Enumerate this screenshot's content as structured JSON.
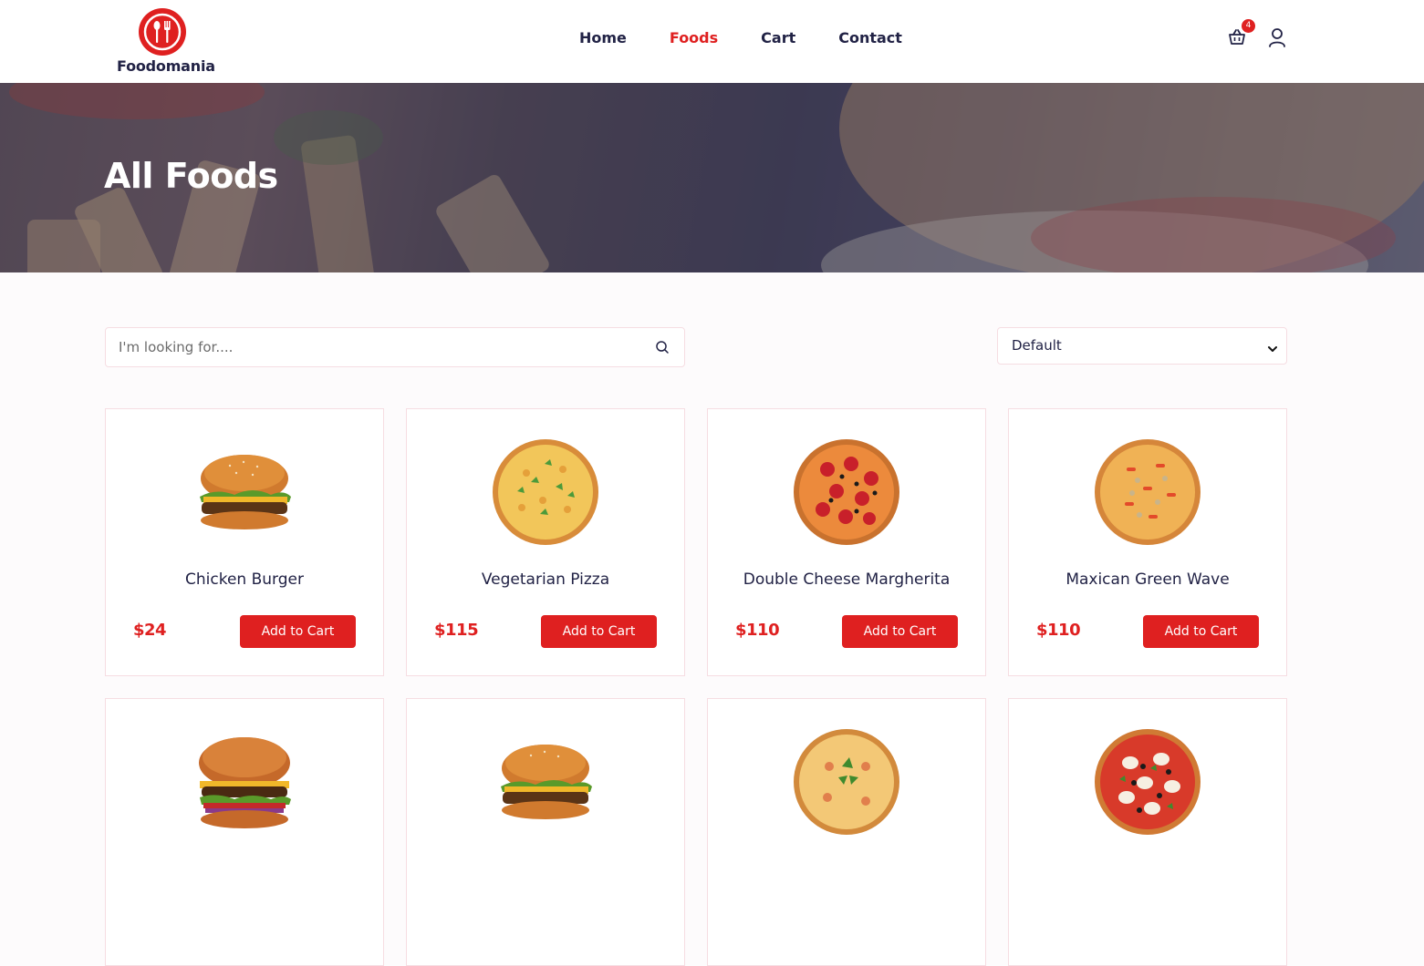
{
  "header": {
    "logo_text": "Foodomania",
    "nav": [
      {
        "label": "Home"
      },
      {
        "label": "Foods"
      },
      {
        "label": "Cart"
      },
      {
        "label": "Contact"
      }
    ],
    "active_nav": "Foods",
    "cart_count": "4",
    "icons": {
      "cart": "basket-icon",
      "user": "user-icon"
    }
  },
  "hero": {
    "title": "All Foods"
  },
  "filters": {
    "search_placeholder": "I'm looking for....",
    "sort_selected": "Default"
  },
  "products": [
    {
      "title": "Chicken Burger",
      "price": "$24",
      "button": "Add to Cart",
      "image": "burger"
    },
    {
      "title": "Vegetarian Pizza",
      "price": "$115",
      "button": "Add to Cart",
      "image": "veg-pizza"
    },
    {
      "title": "Double Cheese Margherita",
      "price": "$110",
      "button": "Add to Cart",
      "image": "pepperoni-pizza"
    },
    {
      "title": "Maxican Green Wave",
      "price": "$110",
      "button": "Add to Cart",
      "image": "veggie-pizza"
    },
    {
      "title": "",
      "price": "",
      "button": "",
      "image": "bacon-burger"
    },
    {
      "title": "",
      "price": "",
      "button": "",
      "image": "burger"
    },
    {
      "title": "",
      "price": "",
      "button": "",
      "image": "basil-pizza"
    },
    {
      "title": "",
      "price": "",
      "button": "",
      "image": "olive-pizza"
    }
  ],
  "colors": {
    "brand": "#df2020",
    "heading": "#212245",
    "border": "#f6dde2"
  }
}
